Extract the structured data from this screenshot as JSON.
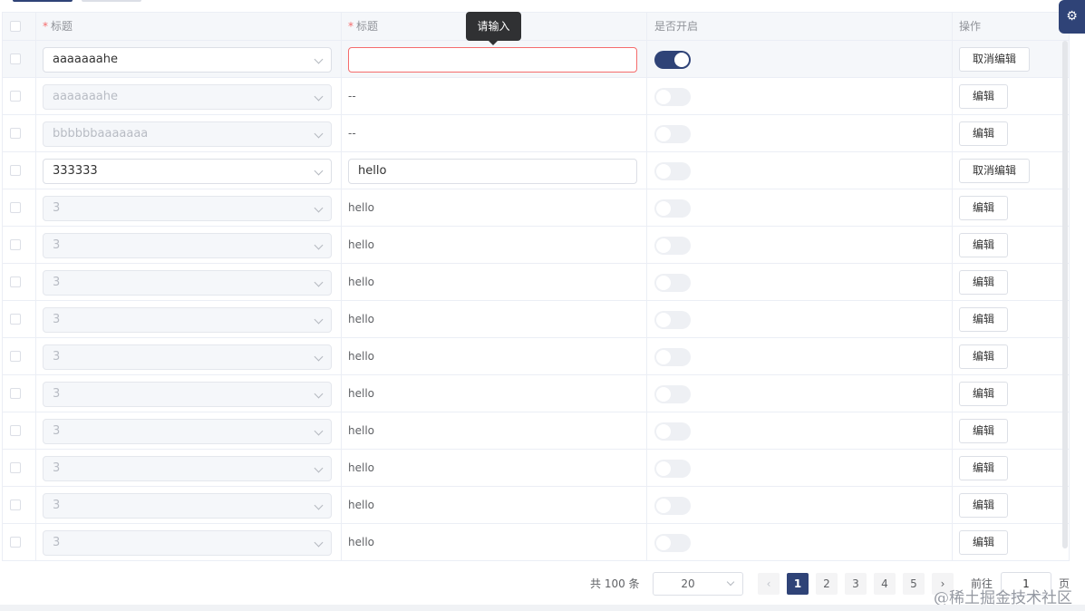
{
  "header": {
    "col1": "标题",
    "col2": "标题",
    "col3": "是否开启",
    "col4": "操作"
  },
  "tooltip": "请输入",
  "rows": [
    {
      "select": "aaaaaaahe",
      "select_disabled": false,
      "text": "",
      "mode": "input-error",
      "switch_on": true,
      "action": "取消编辑",
      "highlight": true
    },
    {
      "select": "aaaaaaahe",
      "select_disabled": true,
      "text": "--",
      "mode": "text",
      "switch_on": false,
      "action": "编辑",
      "highlight": false
    },
    {
      "select": "bbbbbbaaaaaaa",
      "select_disabled": true,
      "text": "--",
      "mode": "text",
      "switch_on": false,
      "action": "编辑",
      "highlight": false
    },
    {
      "select": "333333",
      "select_disabled": false,
      "text": "hello",
      "mode": "input",
      "switch_on": false,
      "action": "取消编辑",
      "highlight": false
    },
    {
      "select": "3",
      "select_disabled": true,
      "text": "hello",
      "mode": "text",
      "switch_on": false,
      "action": "编辑",
      "highlight": false
    },
    {
      "select": "3",
      "select_disabled": true,
      "text": "hello",
      "mode": "text",
      "switch_on": false,
      "action": "编辑",
      "highlight": false
    },
    {
      "select": "3",
      "select_disabled": true,
      "text": "hello",
      "mode": "text",
      "switch_on": false,
      "action": "编辑",
      "highlight": false
    },
    {
      "select": "3",
      "select_disabled": true,
      "text": "hello",
      "mode": "text",
      "switch_on": false,
      "action": "编辑",
      "highlight": false
    },
    {
      "select": "3",
      "select_disabled": true,
      "text": "hello",
      "mode": "text",
      "switch_on": false,
      "action": "编辑",
      "highlight": false
    },
    {
      "select": "3",
      "select_disabled": true,
      "text": "hello",
      "mode": "text",
      "switch_on": false,
      "action": "编辑",
      "highlight": false
    },
    {
      "select": "3",
      "select_disabled": true,
      "text": "hello",
      "mode": "text",
      "switch_on": false,
      "action": "编辑",
      "highlight": false
    },
    {
      "select": "3",
      "select_disabled": true,
      "text": "hello",
      "mode": "text",
      "switch_on": false,
      "action": "编辑",
      "highlight": false
    },
    {
      "select": "3",
      "select_disabled": true,
      "text": "hello",
      "mode": "text",
      "switch_on": false,
      "action": "编辑",
      "highlight": false
    },
    {
      "select": "3",
      "select_disabled": true,
      "text": "hello",
      "mode": "text",
      "switch_on": false,
      "action": "编辑",
      "highlight": false
    }
  ],
  "pagination": {
    "total": "共 100 条",
    "page_size": "20",
    "pages": [
      "1",
      "2",
      "3",
      "4",
      "5"
    ],
    "current": "1",
    "prev": "‹",
    "next": "›",
    "goto_label": "前往",
    "goto_value": "1",
    "page_suffix": "页"
  },
  "settings_icon": "gear-icon",
  "watermark": "@稀土掘金技术社区",
  "colors": {
    "primary": "#2f4377",
    "error": "#f56c6c",
    "header_bg": "#f5f7fa"
  }
}
